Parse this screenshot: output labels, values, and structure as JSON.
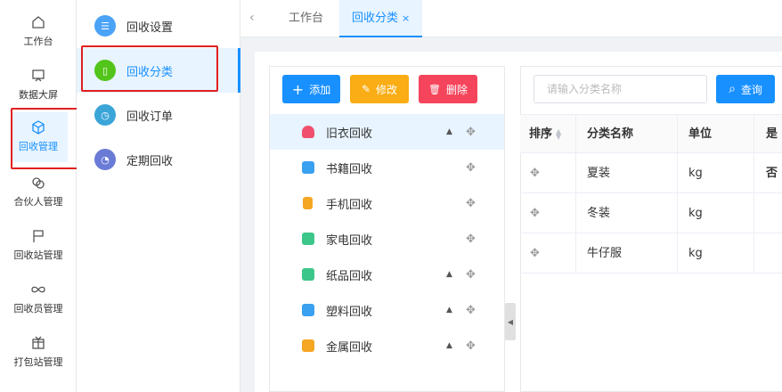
{
  "rail": {
    "items": [
      {
        "label": "工作台",
        "icon": "home-icon"
      },
      {
        "label": "数据大屏",
        "icon": "screen-icon"
      },
      {
        "label": "回收管理",
        "icon": "cube-icon"
      },
      {
        "label": "合伙人管理",
        "icon": "link-icon"
      },
      {
        "label": "回收站管理",
        "icon": "flag-icon"
      },
      {
        "label": "回收员管理",
        "icon": "infinity-icon"
      },
      {
        "label": "打包站管理",
        "icon": "package-icon"
      }
    ]
  },
  "submenu": {
    "items": [
      {
        "label": "回收设置",
        "icon": "list-icon",
        "color": "#4aa3f7"
      },
      {
        "label": "回收分类",
        "icon": "bookmark-icon",
        "color": "#52c41a"
      },
      {
        "label": "回收订单",
        "icon": "clock-icon",
        "color": "#3ba5d8"
      },
      {
        "label": "定期回收",
        "icon": "timer-icon",
        "color": "#6a7bd6"
      }
    ]
  },
  "tabs": {
    "items": [
      {
        "label": "工作台"
      },
      {
        "label": "回收分类",
        "close": "×"
      }
    ]
  },
  "toolbar": {
    "add_label": "添加",
    "edit_label": "修改",
    "delete_label": "删除",
    "add_glyph": "+",
    "edit_glyph": "✎",
    "delete_glyph": "🗑"
  },
  "tree": {
    "items": [
      {
        "label": "旧衣回收",
        "color": "#f0506e",
        "has_up": true
      },
      {
        "label": "书籍回收",
        "color": "#3aa0f0",
        "has_up": false
      },
      {
        "label": "手机回收",
        "color": "#f5a623",
        "has_up": false
      },
      {
        "label": "家电回收",
        "color": "#3cc68a",
        "has_up": false
      },
      {
        "label": "纸品回收",
        "color": "#3cc68a",
        "has_up": true
      },
      {
        "label": "塑料回收",
        "color": "#3aa0f0",
        "has_up": true
      },
      {
        "label": "金属回收",
        "color": "#f5a623",
        "has_up": true
      }
    ],
    "up_glyph": "▲",
    "move_glyph": "✥"
  },
  "search": {
    "placeholder": "请输入分类名称",
    "query_label": "查询",
    "query_glyph": "⌕"
  },
  "table": {
    "headers": [
      "排序",
      "分类名称",
      "单位",
      "是否"
    ],
    "rows": [
      {
        "name": "夏装",
        "unit": "kg"
      },
      {
        "name": "冬装",
        "unit": "kg"
      },
      {
        "name": "牛仔服",
        "unit": "kg"
      }
    ],
    "move_glyph": "✥",
    "sort_up": "▲",
    "sort_down": "▼"
  },
  "collapse_glyph": "◀"
}
